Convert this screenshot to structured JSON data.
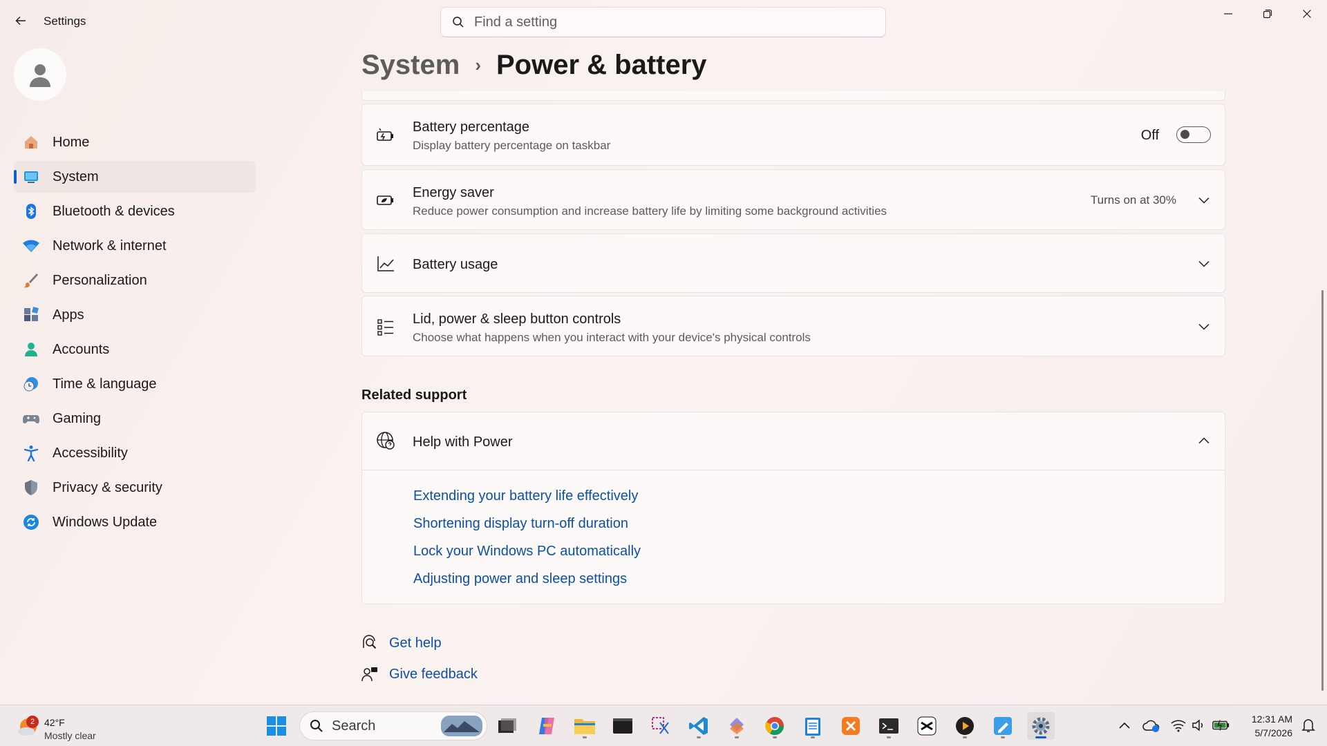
{
  "window": {
    "title": "Settings",
    "search_placeholder": "Find a setting"
  },
  "sidebar": {
    "items": [
      {
        "label": "Home",
        "icon": "home-icon"
      },
      {
        "label": "System",
        "icon": "system-icon",
        "active": true
      },
      {
        "label": "Bluetooth & devices",
        "icon": "bluetooth-icon"
      },
      {
        "label": "Network & internet",
        "icon": "wifi-icon"
      },
      {
        "label": "Personalization",
        "icon": "brush-icon"
      },
      {
        "label": "Apps",
        "icon": "apps-icon"
      },
      {
        "label": "Accounts",
        "icon": "accounts-icon"
      },
      {
        "label": "Time & language",
        "icon": "clock-globe-icon"
      },
      {
        "label": "Gaming",
        "icon": "gamepad-icon"
      },
      {
        "label": "Accessibility",
        "icon": "accessibility-icon"
      },
      {
        "label": "Privacy & security",
        "icon": "shield-icon"
      },
      {
        "label": "Windows Update",
        "icon": "update-icon"
      }
    ]
  },
  "breadcrumb": {
    "parent": "System",
    "separator": "›",
    "current": "Power & battery"
  },
  "settings": {
    "battery_percentage": {
      "title": "Battery percentage",
      "subtitle": "Display battery percentage on taskbar",
      "state": "Off",
      "enabled": false
    },
    "energy_saver": {
      "title": "Energy saver",
      "subtitle": "Reduce power consumption and increase battery life by limiting some background activities",
      "value": "Turns on at 30%"
    },
    "battery_usage": {
      "title": "Battery usage"
    },
    "lid_controls": {
      "title": "Lid, power & sleep button controls",
      "subtitle": "Choose what happens when you interact with your device's physical controls"
    }
  },
  "related_support": {
    "title": "Related support",
    "help_card": {
      "title": "Help with Power",
      "links": [
        "Extending your battery life effectively",
        "Shortening display turn-off duration",
        "Lock your Windows PC automatically",
        "Adjusting power and sleep settings"
      ]
    }
  },
  "footer_links": {
    "get_help": "Get help",
    "give_feedback": "Give feedback"
  },
  "taskbar": {
    "weather": {
      "temp": "42°F",
      "condition": "Mostly clear",
      "badge": "2"
    },
    "search_label": "Search",
    "clock": {
      "time": "12:31 AM",
      "date": "5/7/2026"
    }
  },
  "colors": {
    "accent": "#0f5ec9",
    "link": "#0b4fa8"
  }
}
